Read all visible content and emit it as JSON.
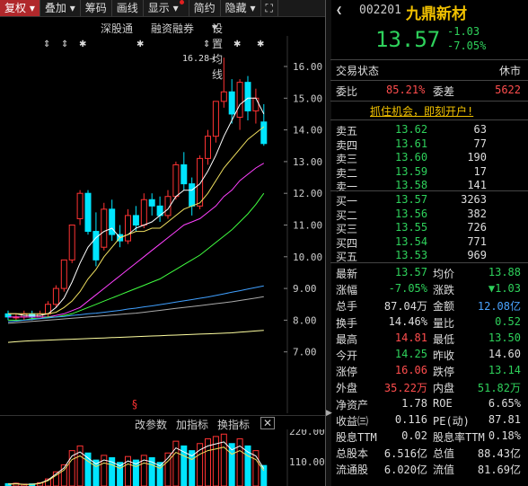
{
  "toolbar": {
    "items": [
      "复权",
      "叠加",
      "筹码",
      "画线",
      "显示",
      "简约",
      "隐藏"
    ],
    "dropdown_marks": [
      "▾",
      "▾"
    ]
  },
  "subtoolbar": {
    "items": [
      "深股通",
      "融资融券",
      "设置均线"
    ]
  },
  "chart": {
    "price_labels": [
      "16.00",
      "15.00",
      "14.00",
      "13.00",
      "12.00",
      "11.00",
      "10.00",
      "9.00",
      "8.00",
      "7.00"
    ],
    "peak_label": "16.28",
    "ex_marker": "§",
    "volume_labels": [
      "220.00",
      "110.00"
    ],
    "colors": {
      "up": "#ff3333",
      "down": "#00e5ff",
      "ma5": "#ffffff",
      "ma10": "#f0e060",
      "ma20": "#ff40ff",
      "ma60": "#40ff40"
    }
  },
  "bottom_tabs": [
    "改参数",
    "加指标",
    "换指标"
  ],
  "stock": {
    "code": "002201",
    "name": "九鼎新材",
    "price": "13.57",
    "change": "-1.03",
    "change_pct": "-7.05%"
  },
  "status": {
    "label": "交易状态",
    "value": "休市"
  },
  "ratio": {
    "label1": "委比",
    "value1": "85.21%",
    "label2": "委差",
    "value2": "5622"
  },
  "promo": "抓住机会，即刻开户!",
  "asks": [
    {
      "label": "卖五",
      "price": "13.62",
      "vol": "63"
    },
    {
      "label": "卖四",
      "price": "13.61",
      "vol": "77"
    },
    {
      "label": "卖三",
      "price": "13.60",
      "vol": "190"
    },
    {
      "label": "卖二",
      "price": "13.59",
      "vol": "17"
    },
    {
      "label": "卖一",
      "price": "13.58",
      "vol": "141"
    }
  ],
  "bids": [
    {
      "label": "买一",
      "price": "13.57",
      "vol": "3263"
    },
    {
      "label": "买二",
      "price": "13.56",
      "vol": "382"
    },
    {
      "label": "买三",
      "price": "13.55",
      "vol": "726"
    },
    {
      "label": "买四",
      "price": "13.54",
      "vol": "771"
    },
    {
      "label": "买五",
      "price": "13.53",
      "vol": "969"
    }
  ],
  "stats": [
    {
      "l1": "最新",
      "v1": "13.57",
      "c1": "g",
      "l2": "均价",
      "v2": "13.88",
      "c2": "g"
    },
    {
      "l1": "涨幅",
      "v1": "-7.05%",
      "c1": "g",
      "l2": "涨跌",
      "v2": "▼1.03",
      "c2": "g"
    },
    {
      "l1": "总手",
      "v1": "87.04万",
      "c1": "w",
      "l2": "金额",
      "v2": "12.08亿",
      "c2": "b"
    },
    {
      "l1": "换手",
      "v1": "14.46%",
      "c1": "w",
      "l2": "量比",
      "v2": "0.52",
      "c2": "g"
    },
    {
      "l1": "最高",
      "v1": "14.81",
      "c1": "r",
      "l2": "最低",
      "v2": "13.50",
      "c2": "g"
    },
    {
      "l1": "今开",
      "v1": "14.25",
      "c1": "g",
      "l2": "昨收",
      "v2": "14.60",
      "c2": "w"
    },
    {
      "l1": "涨停",
      "v1": "16.06",
      "c1": "r",
      "l2": "跌停",
      "v2": "13.14",
      "c2": "g"
    },
    {
      "l1": "外盘",
      "v1": "35.22万",
      "c1": "r",
      "l2": "内盘",
      "v2": "51.82万",
      "c2": "g"
    },
    {
      "l1": "净资产",
      "v1": "1.78",
      "c1": "w",
      "l2": "ROE",
      "v2": "6.65%",
      "c2": "w"
    },
    {
      "l1": "收益㈢",
      "v1": "0.116",
      "c1": "w",
      "l2": "PE(动)",
      "v2": "87.81",
      "c2": "w"
    },
    {
      "l1": "股息TTM",
      "v1": "0.02",
      "c1": "w",
      "l2": "股息率TTM",
      "v2": "0.18%",
      "c2": "w"
    },
    {
      "l1": "总股本",
      "v1": "6.516亿",
      "c1": "w",
      "l2": "总值",
      "v2": "88.43亿",
      "c2": "w"
    },
    {
      "l1": "流通股",
      "v1": "6.020亿",
      "c1": "w",
      "l2": "流值",
      "v2": "81.69亿",
      "c2": "w"
    }
  ]
}
